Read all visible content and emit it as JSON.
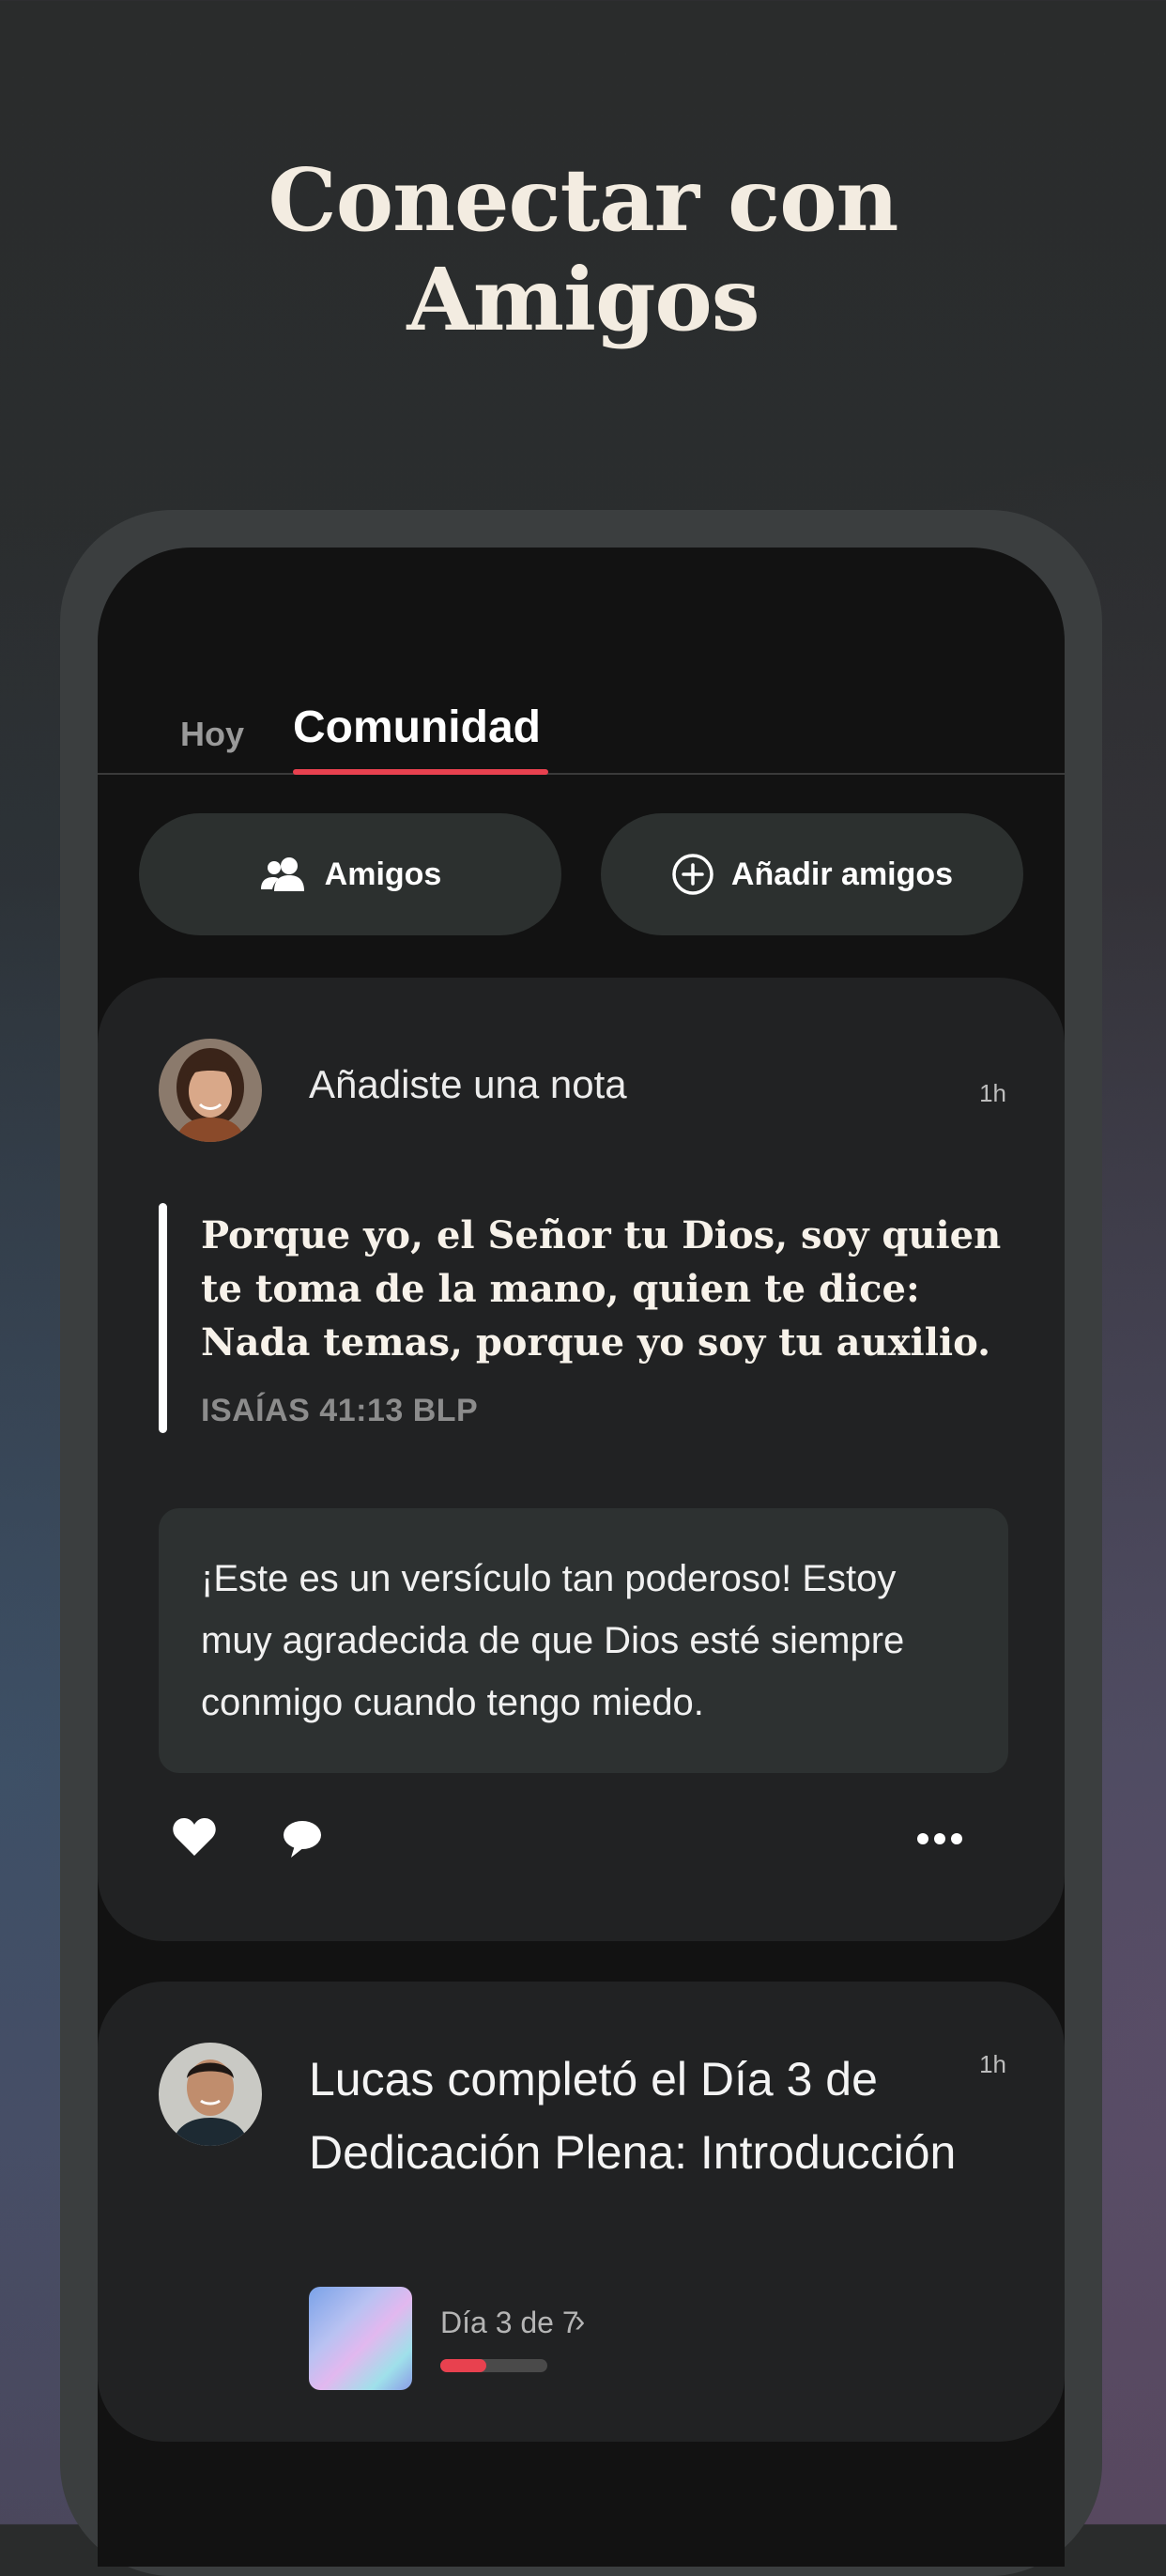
{
  "headline": {
    "line1": "Conectar con",
    "line2": "Amigos"
  },
  "tabs": [
    {
      "label": "Hoy",
      "active": false
    },
    {
      "label": "Comunidad",
      "active": true
    }
  ],
  "buttons": {
    "friends": "Amigos",
    "add_friends": "Añadir amigos"
  },
  "feed": [
    {
      "action": "Añadiste una nota",
      "time": "1h",
      "quote": "Porque yo, el Señor tu Dios, soy quien te toma de la mano, quien te dice: Nada temas, porque yo soy tu auxilio.",
      "reference": "ISAÍAS 41:13 BLP",
      "comment": "¡Este es un versículo tan poderoso! Estoy muy agradecida de que Dios esté siempre conmigo cuando tengo miedo.",
      "icons": [
        "heart-icon",
        "comment-icon",
        "more-icon"
      ]
    },
    {
      "action": "Lucas completó el Día 3 de Dedicación Plena: Introducción",
      "time": "1h",
      "plan_progress_label": "Día 3 de 7",
      "plan_progress_fraction": 0.43
    }
  ],
  "colors": {
    "accent": "#e8414f",
    "headline": "#f3ece1",
    "card": "#212223"
  }
}
